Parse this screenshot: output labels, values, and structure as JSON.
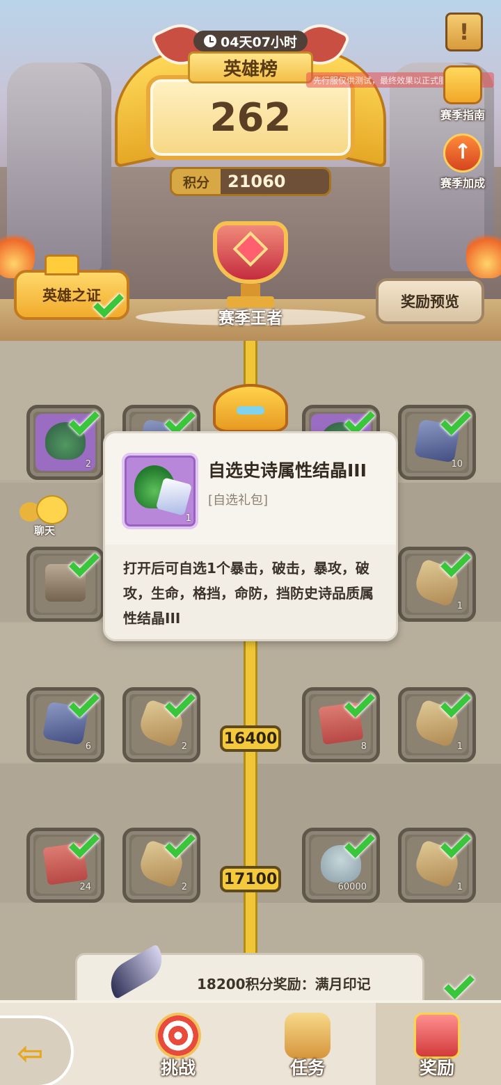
{
  "header": {
    "timer": "04天07小时",
    "board_title": "英雄榜",
    "rank": "262",
    "score_label": "积分",
    "score_value": "21060",
    "disclaimer": "先行服仅供测试，最终效果以正式服为准"
  },
  "side_buttons": {
    "info_icon": "!",
    "season_guide": "赛季指南",
    "season_bonus": "赛季加成"
  },
  "trophy_label": "赛季王者",
  "buttons": {
    "hero_proof": "英雄之证",
    "reward_preview": "奖励预览"
  },
  "chat_label": "聊天",
  "tooltip": {
    "count": "1",
    "title": "自选史诗属性结晶III",
    "subtitle": "[自选礼包]",
    "description": "打开后可自选1个暴击，破击，暴攻，破攻，生命，格挡，命防，挡防史诗品质属性结晶III"
  },
  "track": {
    "rows": [
      {
        "score": "",
        "left": [
          {
            "item": "bag",
            "count": "2",
            "purple": true
          },
          {
            "item": "crystal",
            "count": ""
          }
        ],
        "right": [
          {
            "item": "bag",
            "count": "",
            "purple": true
          },
          {
            "item": "crystal",
            "count": "10"
          }
        ]
      },
      {
        "score": "",
        "left": [
          {
            "item": "chest",
            "count": ""
          },
          {
            "item": "ore",
            "count": ""
          }
        ],
        "right": [
          {
            "item": "ore",
            "count": ""
          },
          {
            "item": "ore",
            "count": "1"
          }
        ]
      },
      {
        "score": "16400",
        "left": [
          {
            "item": "crystal",
            "count": "6"
          },
          {
            "item": "ore",
            "count": "2"
          }
        ],
        "right": [
          {
            "item": "ticket",
            "count": "8"
          },
          {
            "item": "ore",
            "count": "1"
          }
        ]
      },
      {
        "score": "17100",
        "left": [
          {
            "item": "ticket",
            "count": "24"
          },
          {
            "item": "ore",
            "count": "2"
          }
        ],
        "right": [
          {
            "item": "shell",
            "count": "60000"
          },
          {
            "item": "ore",
            "count": "1"
          }
        ]
      }
    ]
  },
  "milestone_banner": "18200积分奖励：满月印记",
  "nav": {
    "back_icon": "back-arrow-icon",
    "challenge": "挑战",
    "tasks": "任务",
    "rewards": "奖励",
    "selected": "rewards"
  },
  "colors": {
    "rope": "#f0c636",
    "check": "#3ac63a",
    "gold": "#f1ab2c"
  }
}
